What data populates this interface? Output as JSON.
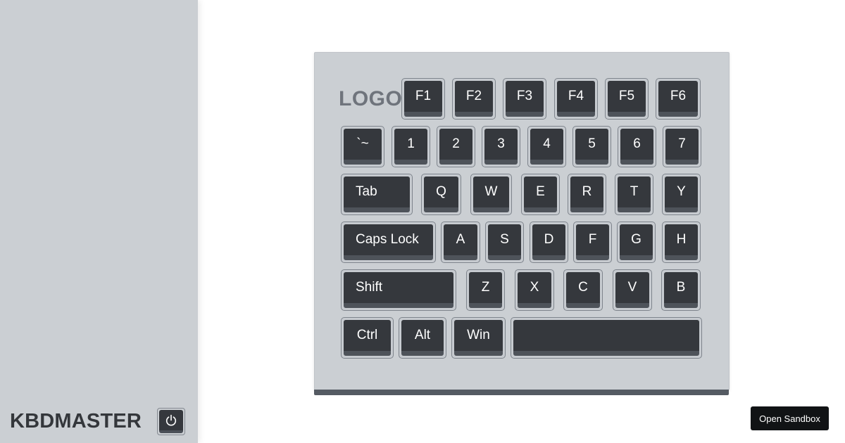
{
  "sidebar": {
    "brand": "KBDMASTER",
    "power_icon": "power-icon"
  },
  "keyboard": {
    "logo": "LOGO",
    "rows": [
      [
        "F1",
        "F2",
        "F3",
        "F4",
        "F5",
        "F6"
      ],
      [
        "`~",
        "1",
        "2",
        "3",
        "4",
        "5",
        "6",
        "7"
      ],
      [
        "Tab",
        "Q",
        "W",
        "E",
        "R",
        "T",
        "Y"
      ],
      [
        "Caps Lock",
        "A",
        "S",
        "D",
        "F",
        "G",
        "H"
      ],
      [
        "Shift",
        "Z",
        "X",
        "C",
        "V",
        "B"
      ],
      [
        "Ctrl",
        "Alt",
        "Win",
        ""
      ]
    ]
  },
  "sandbox": {
    "label": "Open Sandbox"
  },
  "colors": {
    "sidebar_bg": "#cbcfd3",
    "keycap": "#35383d",
    "keycap_edge": "#4e535a",
    "logo": "#6f747c",
    "brand": "#34373b",
    "button_bg": "#111315"
  }
}
